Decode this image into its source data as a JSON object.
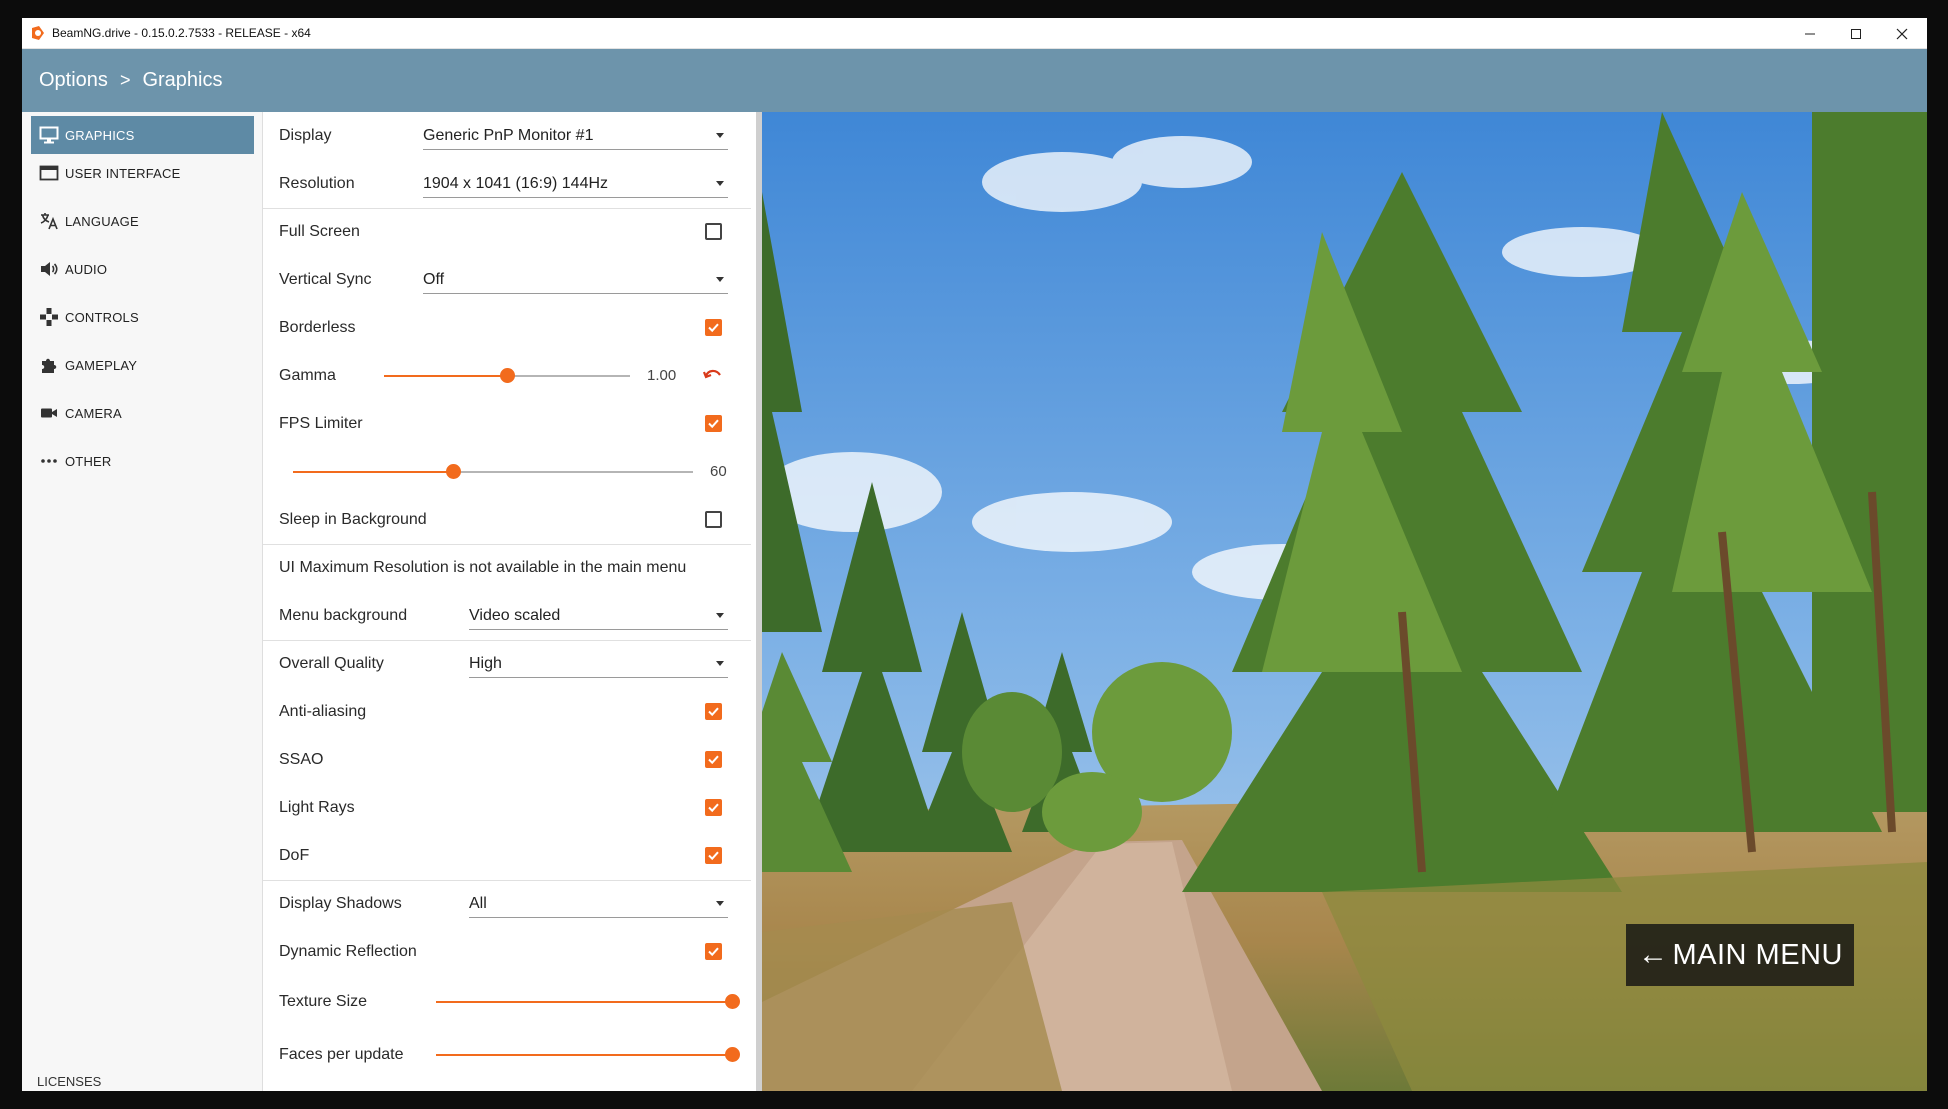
{
  "window": {
    "title": "BeamNG.drive - 0.15.0.2.7533 - RELEASE - x64"
  },
  "breadcrumb": {
    "root": "Options",
    "separator": ">",
    "current": "Graphics"
  },
  "sidebar": {
    "items": [
      {
        "label": "GRAPHICS",
        "icon": "monitor-icon",
        "active": true
      },
      {
        "label": "USER INTERFACE",
        "icon": "window-icon",
        "active": false
      },
      {
        "label": "LANGUAGE",
        "icon": "translate-icon",
        "active": false
      },
      {
        "label": "AUDIO",
        "icon": "speaker-icon",
        "active": false
      },
      {
        "label": "CONTROLS",
        "icon": "gamepad-icon",
        "active": false
      },
      {
        "label": "GAMEPLAY",
        "icon": "puzzle-icon",
        "active": false
      },
      {
        "label": "CAMERA",
        "icon": "camera-icon",
        "active": false
      },
      {
        "label": "OTHER",
        "icon": "more-dots-icon",
        "active": false
      }
    ],
    "licenses": "LICENSES"
  },
  "settings": {
    "display": {
      "label": "Display",
      "value": "Generic PnP Monitor #1"
    },
    "resolution": {
      "label": "Resolution",
      "value": "1904 x 1041 (16:9) 144Hz"
    },
    "full_screen": {
      "label": "Full Screen",
      "checked": false
    },
    "vertical_sync": {
      "label": "Vertical Sync",
      "value": "Off"
    },
    "borderless": {
      "label": "Borderless",
      "checked": true
    },
    "gamma": {
      "label": "Gamma",
      "value_text": "1.00",
      "level": 0.5
    },
    "fps_limiter": {
      "label": "FPS Limiter",
      "checked": true,
      "value_text": "60",
      "level": 0.4
    },
    "sleep_in_background": {
      "label": "Sleep in Background",
      "checked": false
    },
    "ui_notice": "UI Maximum Resolution is not available in the main menu",
    "menu_background": {
      "label": "Menu background",
      "value": "Video scaled"
    },
    "overall_quality": {
      "label": "Overall Quality",
      "value": "High"
    },
    "anti_aliasing": {
      "label": "Anti-aliasing",
      "checked": true
    },
    "ssao": {
      "label": "SSAO",
      "checked": true
    },
    "light_rays": {
      "label": "Light Rays",
      "checked": true
    },
    "dof": {
      "label": "DoF",
      "checked": true
    },
    "display_shadows": {
      "label": "Display Shadows",
      "value": "All"
    },
    "dynamic_reflection": {
      "label": "Dynamic Reflection",
      "checked": true
    },
    "texture_size": {
      "label": "Texture Size",
      "level": 1.0
    },
    "faces_per_update": {
      "label": "Faces per update",
      "level": 1.0
    }
  },
  "main_menu_button": {
    "label": "MAIN MENU"
  },
  "colors": {
    "accent": "#f26b1d",
    "header": "#6d94ab",
    "sidebar_active": "#5e8aa5"
  }
}
